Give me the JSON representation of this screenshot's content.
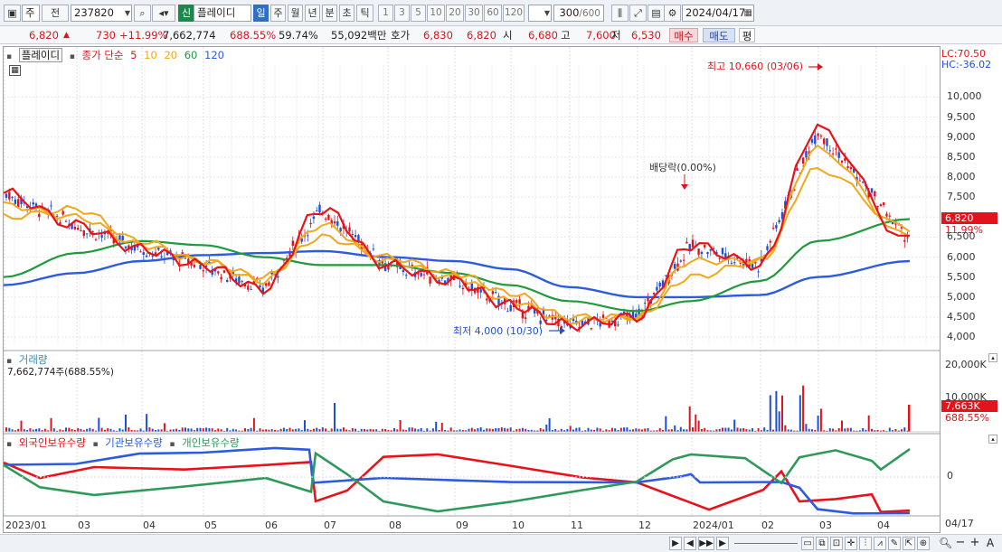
{
  "toolbar": {
    "market_label": "주",
    "prev_label": "전",
    "code": "237820",
    "shin_label": "신",
    "stock_name": "플레이디",
    "periods": [
      "일",
      "주",
      "월",
      "년",
      "분",
      "초",
      "틱"
    ],
    "active_period": "일",
    "intervals": [
      "1",
      "3",
      "5",
      "10",
      "20",
      "30",
      "60",
      "120"
    ],
    "count_value": "300",
    "count_max": "/600",
    "date": "2024/04/17"
  },
  "quote": {
    "price": "6,820",
    "change": "730",
    "change_pct": "+11.99%",
    "volume": "7,662,774",
    "vol_ratio": "688.55%",
    "turnover": "59.74%",
    "amount": "55,092백만",
    "ask_label": "호가",
    "ask1": "6,830",
    "ask2": "6,820",
    "open_label": "시",
    "open": "6,680",
    "high_label": "고",
    "high": "7,600",
    "low_label": "저",
    "low": "6,530",
    "buy_label": "매수",
    "sell_label": "매도",
    "even_label": "평"
  },
  "price_panel": {
    "legend_name": "플레이디",
    "legend_title": "종가 단순",
    "ma_periods": [
      "5",
      "10",
      "20",
      "60",
      "120"
    ],
    "ma_colors": [
      "#e8131a",
      "#f0a81c",
      "#f0a81c",
      "#1f9a3c",
      "#2d5be0"
    ],
    "lc_label": "LC:70.50",
    "hc_label": "HC:-36.02",
    "high_annotation": "최고 10,660 (03/06)",
    "low_annotation": "최저 4,000 (10/30)",
    "dividend_annotation": "배당락(0.00%)",
    "price_ticks": [
      "10,000",
      "9,500",
      "9,000",
      "8,500",
      "8,000",
      "7,500",
      "7,000",
      "6,500",
      "6,000",
      "5,500",
      "5,000",
      "4,500",
      "4,000"
    ],
    "current_price_label": "6,820",
    "current_change_label": "11.99%"
  },
  "volume_panel": {
    "title": "거래량",
    "value_text": "7,662,774주(688.55%)",
    "ticks": [
      "20,000K",
      "10,000K"
    ],
    "current_label": "7,663K",
    "current_pct": "688.55%"
  },
  "holder_panel": {
    "series": [
      "외국인보유수량",
      "기관보유수량",
      "개인보유수량"
    ],
    "colors": [
      "#e8131a",
      "#2d5be0",
      "#2e9a5a"
    ],
    "zero_label": "0"
  },
  "x_axis": {
    "labels": [
      "2023/01",
      "03",
      "04",
      "05",
      "06",
      "07",
      "08",
      "09",
      "10",
      "11",
      "12",
      "2024/01",
      "02",
      "03",
      "04"
    ],
    "right_date": "04/17"
  },
  "bottom": {
    "play_label": "▶",
    "nav": [
      "◀",
      "▶▶",
      "▶"
    ]
  },
  "chart_data": {
    "type": "line",
    "series": [
      {
        "name": "종가 단순 5",
        "x": [
          "2023/01",
          "03",
          "04",
          "05",
          "06",
          "07",
          "08",
          "09",
          "10",
          "11",
          "12",
          "2024/01",
          "02",
          "03",
          "04"
        ],
        "values": [
          7600,
          6800,
          6200,
          5800,
          5200,
          7200,
          5800,
          5400,
          4800,
          4300,
          4500,
          6300,
          5800,
          9200,
          6400
        ]
      },
      {
        "name": "10",
        "x": [
          "2023/01",
          "03",
          "04",
          "05",
          "06",
          "07",
          "08",
          "09",
          "10",
          "11",
          "12",
          "2024/01",
          "02",
          "03",
          "04"
        ],
        "values": [
          7300,
          7000,
          6300,
          5900,
          5400,
          6800,
          5900,
          5500,
          4900,
          4400,
          4500,
          5900,
          5900,
          8700,
          6500
        ]
      },
      {
        "name": "20",
        "x": [
          "2023/01",
          "03",
          "04",
          "05",
          "06",
          "07",
          "08",
          "09",
          "10",
          "11",
          "12",
          "2024/01",
          "02",
          "03",
          "04"
        ],
        "values": [
          7000,
          7200,
          6400,
          5900,
          5500,
          6500,
          6000,
          5600,
          5100,
          4500,
          4500,
          5500,
          5900,
          8200,
          6700
        ]
      },
      {
        "name": "60",
        "x": [
          "2023/01",
          "03",
          "04",
          "05",
          "06",
          "07",
          "08",
          "09",
          "10",
          "11",
          "12",
          "2024/01",
          "02",
          "03",
          "04"
        ],
        "values": [
          5500,
          6100,
          6400,
          6300,
          6000,
          5800,
          5800,
          5600,
          5300,
          4900,
          4650,
          4900,
          5400,
          6400,
          6950
        ]
      },
      {
        "name": "120",
        "x": [
          "2023/01",
          "03",
          "04",
          "05",
          "06",
          "07",
          "08",
          "09",
          "10",
          "11",
          "12",
          "2024/01",
          "02",
          "03",
          "04"
        ],
        "values": [
          5300,
          5600,
          5900,
          6050,
          6100,
          6150,
          6000,
          5900,
          5700,
          5250,
          5000,
          5000,
          5050,
          5500,
          5900
        ]
      }
    ],
    "ylim": [
      3800,
      10800
    ],
    "high": {
      "value": 10660,
      "date": "03/06"
    },
    "low": {
      "value": 4000,
      "date": "10/30"
    }
  }
}
